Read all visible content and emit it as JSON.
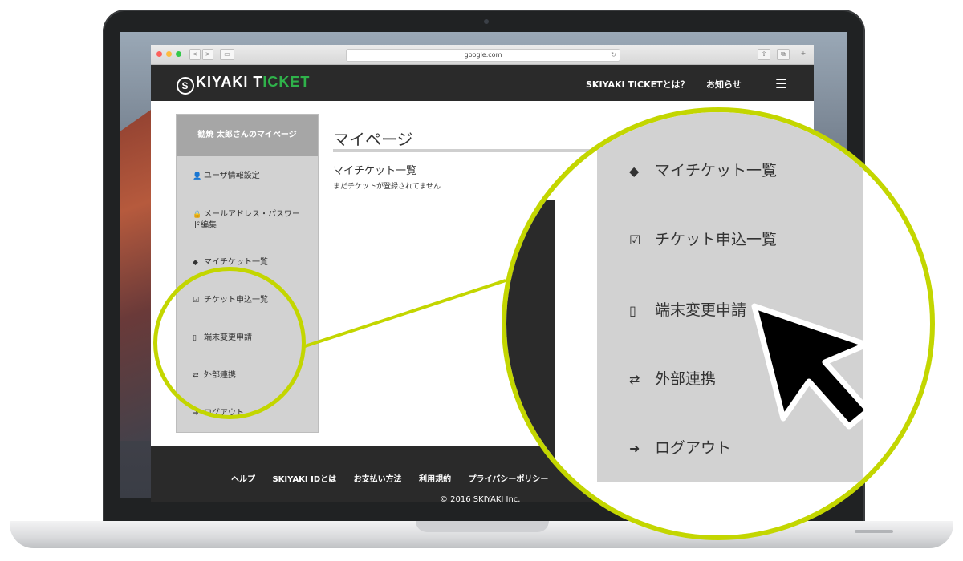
{
  "browser": {
    "url": "google.com",
    "nav_back": "<",
    "nav_fwd": ">",
    "reload_glyph": "↻"
  },
  "header": {
    "logo_mark": "S",
    "logo_text_1": "KIYAKI T",
    "logo_text_2": "I",
    "logo_text_3": "CKET",
    "link_about": "SKIYAKI TICKETとは？",
    "link_news": "お知らせ",
    "menu_glyph": "☰"
  },
  "sidebar": {
    "heading": "勧焼 太郎さんのマイページ",
    "items": [
      {
        "icon": "user-icon",
        "glyph": "👤",
        "label": "ユーザ情報設定"
      },
      {
        "icon": "lock-icon",
        "glyph": "🔒",
        "label": "メールアドレス・パスワード編集"
      },
      {
        "icon": "ticket-icon",
        "glyph": "◆",
        "label": "マイチケット一覧"
      },
      {
        "icon": "checkbox-icon",
        "glyph": "☑",
        "label": "チケット申込一覧"
      },
      {
        "icon": "mobile-icon",
        "glyph": "▯",
        "label": "端末変更申請"
      },
      {
        "icon": "exchange-icon",
        "glyph": "⇄",
        "label": "外部連携"
      },
      {
        "icon": "logout-icon",
        "glyph": "➜",
        "label": "ログアウト"
      }
    ]
  },
  "main": {
    "title": "マイページ",
    "subtitle": "マイチケット一覧",
    "empty_text": "まだチケットが登録されてません"
  },
  "footer": {
    "links": [
      "ヘルプ",
      "SKIYAKI IDとは",
      "お支払い方法",
      "利用規約",
      "プライバシーポリシー"
    ],
    "copyright": "© 2016 SKIYAKI Inc."
  },
  "zoom": {
    "items": [
      {
        "icon": "ticket-icon",
        "glyph": "◆",
        "label": "マイチケット一覧"
      },
      {
        "icon": "checkbox-icon",
        "glyph": "☑",
        "label": "チケット申込一覧"
      },
      {
        "icon": "mobile-icon",
        "glyph": "▯",
        "label": "端末変更申請"
      },
      {
        "icon": "exchange-icon",
        "glyph": "⇄",
        "label": "外部連携"
      },
      {
        "icon": "logout-icon",
        "glyph": "➜",
        "label": "ログアウト"
      }
    ]
  },
  "colors": {
    "accent": "#c3d600",
    "brand_green": "#2fb24a",
    "header_bg": "#2a2a2a",
    "sidebar_bg": "#d2d2d2"
  }
}
